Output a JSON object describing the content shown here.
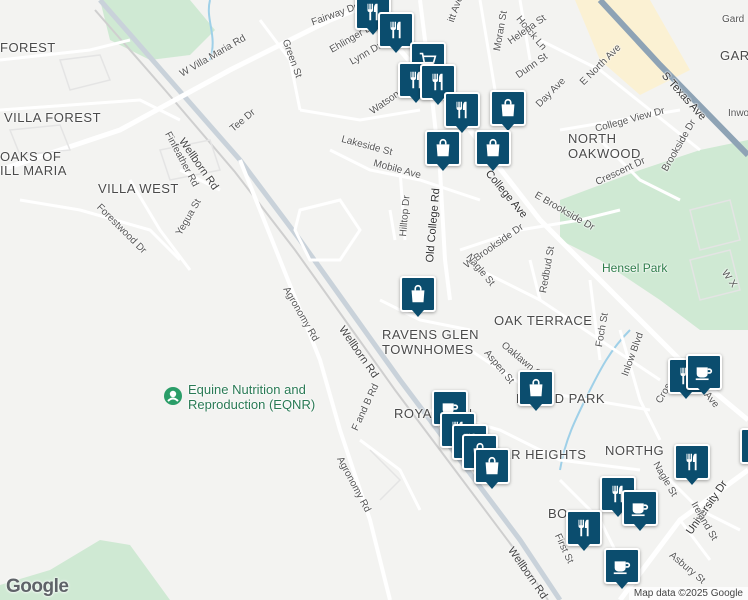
{
  "map": {
    "attribution": "Map data ©2025 Google",
    "logo": "Google"
  },
  "areas": [
    {
      "id": "forest",
      "text": "FOREST"
    },
    {
      "id": "villa-forest",
      "text": "VILLA FOREST"
    },
    {
      "id": "oaks",
      "text": "OAKS OF\nILL MARIA"
    },
    {
      "id": "villa-west",
      "text": "VILLA WEST"
    },
    {
      "id": "north-oakwood",
      "text": "NORTH\nOAKWOOD"
    },
    {
      "id": "ravens-glen",
      "text": "RAVENS GLEN\nTOWNHOMES"
    },
    {
      "id": "oak-terrace",
      "text": "OAK TERRACE"
    },
    {
      "id": "highland-park",
      "text": "HIGH  D PARK"
    },
    {
      "id": "royal-glen",
      "text": "ROYA  GLEN"
    },
    {
      "id": "heights",
      "text": "ER HEIGHTS"
    },
    {
      "id": "northgate",
      "text": "NORTHG"
    },
    {
      "id": "bo",
      "text": "BO"
    },
    {
      "id": "gar",
      "text": "GAR"
    }
  ],
  "parks": [
    {
      "id": "hensel-park",
      "text": "Hensel Park"
    }
  ],
  "poi": {
    "icon": "place-marker-icon",
    "text": "Equine Nutrition and\nReproduction (EQNR)"
  },
  "roads": [
    {
      "id": "w-villa-maria",
      "text": "W Villa Maria Rd"
    },
    {
      "id": "wellborn-1",
      "text": "Wellborn Rd"
    },
    {
      "id": "wellborn-2",
      "text": "Wellborn Rd"
    },
    {
      "id": "wellborn-3",
      "text": "Wellborn Rd"
    },
    {
      "id": "s-texas",
      "text": "S Texas Ave"
    },
    {
      "id": "college-ave",
      "text": "College Ave"
    },
    {
      "id": "old-college",
      "text": "Old College Rd"
    },
    {
      "id": "agronomy-1",
      "text": "Agronomy Rd"
    },
    {
      "id": "agronomy-2",
      "text": "Agronomy Rd"
    },
    {
      "id": "f-and-b",
      "text": "F and B Rd"
    },
    {
      "id": "university",
      "text": "University Dr"
    },
    {
      "id": "fairway",
      "text": "Fairway Dr"
    },
    {
      "id": "ehlinger",
      "text": "Ehlinger Dr"
    },
    {
      "id": "lynn",
      "text": "Lynn Dr"
    },
    {
      "id": "green",
      "text": "Green St"
    },
    {
      "id": "watson",
      "text": "Watson St"
    },
    {
      "id": "moran",
      "text": "Moran St"
    },
    {
      "id": "holick",
      "text": "Holick Ln"
    },
    {
      "id": "helena",
      "text": "Helena St"
    },
    {
      "id": "dunn",
      "text": "Dunn St"
    },
    {
      "id": "e-north",
      "text": "E North Ave"
    },
    {
      "id": "day",
      "text": "Day Ave"
    },
    {
      "id": "college-view",
      "text": "College View Dr"
    },
    {
      "id": "lakeside",
      "text": "Lakeside St"
    },
    {
      "id": "mobile",
      "text": "Mobile Ave"
    },
    {
      "id": "hilltop",
      "text": "Hilltop Dr"
    },
    {
      "id": "tee",
      "text": "Tee Dr"
    },
    {
      "id": "finfeather",
      "text": "Finfeather Rd"
    },
    {
      "id": "forestwood",
      "text": "Forestwood Dr"
    },
    {
      "id": "yegua",
      "text": "Yegua St"
    },
    {
      "id": "crescent",
      "text": "Crescent Dr"
    },
    {
      "id": "e-brookside",
      "text": "E Brookside Dr"
    },
    {
      "id": "w-brookside",
      "text": "W Brookside Dr"
    },
    {
      "id": "brookside-dr",
      "text": "Brookside Dr"
    },
    {
      "id": "nagle-1",
      "text": "Nagle St"
    },
    {
      "id": "nagle-2",
      "text": "Nagle St"
    },
    {
      "id": "redbud",
      "text": "Redbud St"
    },
    {
      "id": "oaklawn",
      "text": "Oaklawn St"
    },
    {
      "id": "aspen",
      "text": "Aspen St"
    },
    {
      "id": "foch",
      "text": "Foch St"
    },
    {
      "id": "inlow",
      "text": "Inlow Blvd"
    },
    {
      "id": "ireland",
      "text": "Ireland St"
    },
    {
      "id": "asbury",
      "text": "Asbury St"
    },
    {
      "id": "first",
      "text": "First St"
    },
    {
      "id": "inwo",
      "text": "Inwo"
    },
    {
      "id": "gard",
      "text": "Gard"
    },
    {
      "id": "wx",
      "text": "W X"
    },
    {
      "id": "cros",
      "text": "Cros"
    },
    {
      "id": "ave",
      "text": "Ave"
    },
    {
      "id": "mitt",
      "text": "itt Ave"
    }
  ],
  "pins": [
    {
      "id": 1,
      "icon": "restaurant-icon"
    },
    {
      "id": 2,
      "icon": "restaurant-icon"
    },
    {
      "id": 3,
      "icon": "grocery-cart-icon"
    },
    {
      "id": 4,
      "icon": "restaurant-icon"
    },
    {
      "id": 5,
      "icon": "restaurant-icon"
    },
    {
      "id": 6,
      "icon": "restaurant-icon"
    },
    {
      "id": 7,
      "icon": "shopping-bag-icon"
    },
    {
      "id": 8,
      "icon": "shopping-bag-icon"
    },
    {
      "id": 9,
      "icon": "shopping-bag-icon"
    },
    {
      "id": 10,
      "icon": "shopping-bag-icon"
    },
    {
      "id": 11,
      "icon": "cafe-icon"
    },
    {
      "id": 12,
      "icon": "restaurant-icon"
    },
    {
      "id": 13,
      "icon": "restaurant-icon"
    },
    {
      "id": 14,
      "icon": "shopping-bag-icon"
    },
    {
      "id": 15,
      "icon": "shopping-bag-icon"
    },
    {
      "id": 16,
      "icon": "shopping-bag-icon"
    },
    {
      "id": 17,
      "icon": "restaurant-icon"
    },
    {
      "id": 18,
      "icon": "cafe-icon"
    },
    {
      "id": 19,
      "icon": "restaurant-icon"
    },
    {
      "id": 20,
      "icon": "cafe-icon"
    },
    {
      "id": 21,
      "icon": "restaurant-icon"
    },
    {
      "id": 22,
      "icon": "cafe-icon"
    },
    {
      "id": 23,
      "icon": "restaurant-icon"
    },
    {
      "id": 24,
      "icon": "cafe-icon"
    }
  ],
  "colors": {
    "pin": "#0b4d6e",
    "park": "#cfe9d3",
    "highway": "#8ea3b5",
    "water": "#9fd0e8",
    "campus": "#fbf1d3"
  }
}
